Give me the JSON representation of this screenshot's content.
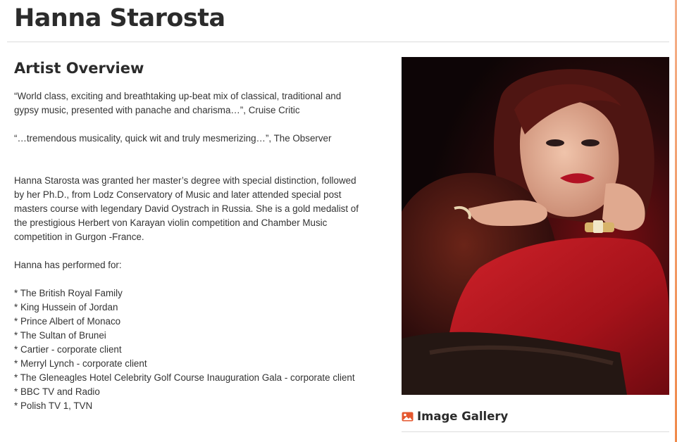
{
  "page": {
    "title": "Hanna Starosta",
    "accent_color": "#f08a4b"
  },
  "overview": {
    "heading": "Artist Overview",
    "quotes": [
      "“World class, exciting and breathtaking up-beat mix of classical, traditional and gypsy music, presented with panache and charisma…”, Cruise Critic",
      "“…tremendous musicality, quick wit and truly mesmerizing…”, The Observer"
    ],
    "bio": "Hanna Starosta was granted her master’s degree with special distinction, followed by her Ph.D., from Lodz Conservatory of Music and later attended special post masters course with legendary David Oystrach in Russia. She is a gold medalist of the prestigious Herbert von Karayan violin competition and Chamber Music competition in Gurgon -France.",
    "performed_intro": "Hanna has performed for:",
    "performed_for": [
      "The British Royal Family",
      "King Hussein of Jordan",
      "Prince Albert of Monaco",
      "The Sultan of Brunei",
      "Cartier - corporate client",
      "Merryl Lynch - corporate client",
      "The Gleneagles Hotel Celebrity Golf Course Inauguration Gala - corporate client",
      "BBC TV and Radio",
      "Polish TV 1, TVN"
    ]
  },
  "sidebar": {
    "portrait_colors": {
      "background": "#120708",
      "dress": "#b3141c",
      "hair": "#5a1a16",
      "fur": "#4a1410",
      "skin": "#e6b49a"
    },
    "gallery": {
      "label": "Image Gallery",
      "icon": "image-icon",
      "icon_color": "#e4572e"
    }
  }
}
